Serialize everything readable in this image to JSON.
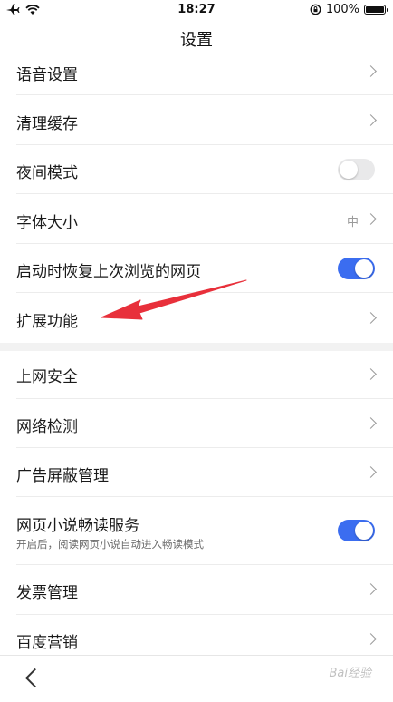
{
  "status_bar": {
    "time": "18:27",
    "battery_percent": "100%"
  },
  "header": {
    "title": "设置"
  },
  "settings": [
    {
      "label": "语音设置",
      "control": "chevron"
    },
    {
      "label": "清理缓存",
      "control": "chevron"
    },
    {
      "label": "夜间模式",
      "control": "toggle",
      "on": false
    },
    {
      "label": "字体大小",
      "control": "chevron",
      "value": "中"
    },
    {
      "label": "启动时恢复上次浏览的网页",
      "control": "toggle",
      "on": true
    },
    {
      "label": "扩展功能",
      "control": "chevron"
    },
    {
      "label": "上网安全",
      "control": "chevron"
    },
    {
      "label": "网络检测",
      "control": "chevron"
    },
    {
      "label": "广告屏蔽管理",
      "control": "chevron"
    },
    {
      "label": "网页小说畅读服务",
      "sub": "开启后，阅读网页小说自动进入畅读模式",
      "control": "toggle",
      "on": true
    },
    {
      "label": "发票管理",
      "control": "chevron"
    },
    {
      "label": "百度营销",
      "control": "chevron"
    }
  ],
  "watermark": "Bai经验",
  "colors": {
    "accent": "#3b6df0",
    "annotation_arrow": "#e8303b",
    "toggle_off": "#e9e9ea"
  }
}
